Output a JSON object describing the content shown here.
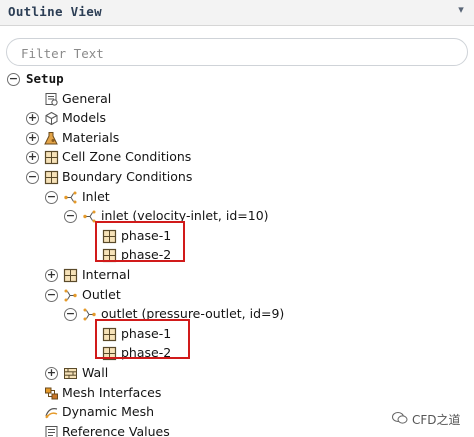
{
  "panel": {
    "title": "Outline View"
  },
  "filter": {
    "placeholder": "Filter Text"
  },
  "tree": {
    "setup": "Setup",
    "general": "General",
    "models": "Models",
    "materials": "Materials",
    "cell_zone_conditions": "Cell Zone Conditions",
    "boundary_conditions": "Boundary Conditions",
    "inlet": "Inlet",
    "inlet_item": "inlet (velocity-inlet, id=10)",
    "inlet_phase1": "phase-1",
    "inlet_phase2": "phase-2",
    "internal": "Internal",
    "outlet": "Outlet",
    "outlet_item": "outlet (pressure-outlet, id=9)",
    "outlet_phase1": "phase-1",
    "outlet_phase2": "phase-2",
    "wall": "Wall",
    "mesh_interfaces": "Mesh Interfaces",
    "dynamic_mesh": "Dynamic Mesh",
    "reference_values": "Reference Values"
  },
  "expanders": {
    "expanded": "−",
    "collapsed": "+"
  },
  "watermark": {
    "text": "CFD之道"
  },
  "colors": {
    "highlight": "#d11a1a",
    "header_bg": "#f3f3f3",
    "title": "#2c3e55"
  }
}
